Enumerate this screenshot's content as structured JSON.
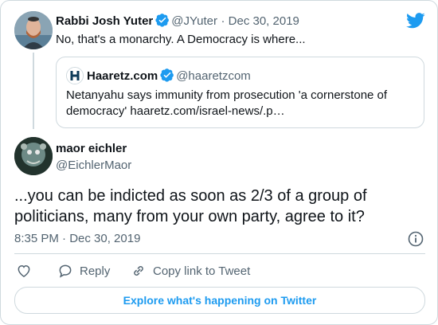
{
  "parent": {
    "name": "Rabbi Josh Yuter",
    "handle": "@JYuter",
    "date": "· Dec 30, 2019",
    "text": "No, that's a monarchy. A Democracy is where..."
  },
  "quote": {
    "name": "Haaretz.com",
    "handle": "@haaretzcom",
    "text_line1": "Netanyahu says immunity from prosecution 'a cornerstone of",
    "text_line2": "democracy' haaretz.com/israel-news/.p…"
  },
  "tweet": {
    "name": "maor eichler",
    "handle": "@EichlerMaor",
    "text": "...you can be indicted as soon as 2/3 of a group of politicians, many from your own party, agree to it?",
    "timestamp": "8:35 PM · Dec 30, 2019"
  },
  "actions": {
    "reply": "Reply",
    "copy_link": "Copy link to Tweet"
  },
  "explore_label": "Explore what's happening on Twitter",
  "colors": {
    "brand": "#1d9bf0",
    "secondary": "#536471",
    "border": "#cfd9de"
  }
}
